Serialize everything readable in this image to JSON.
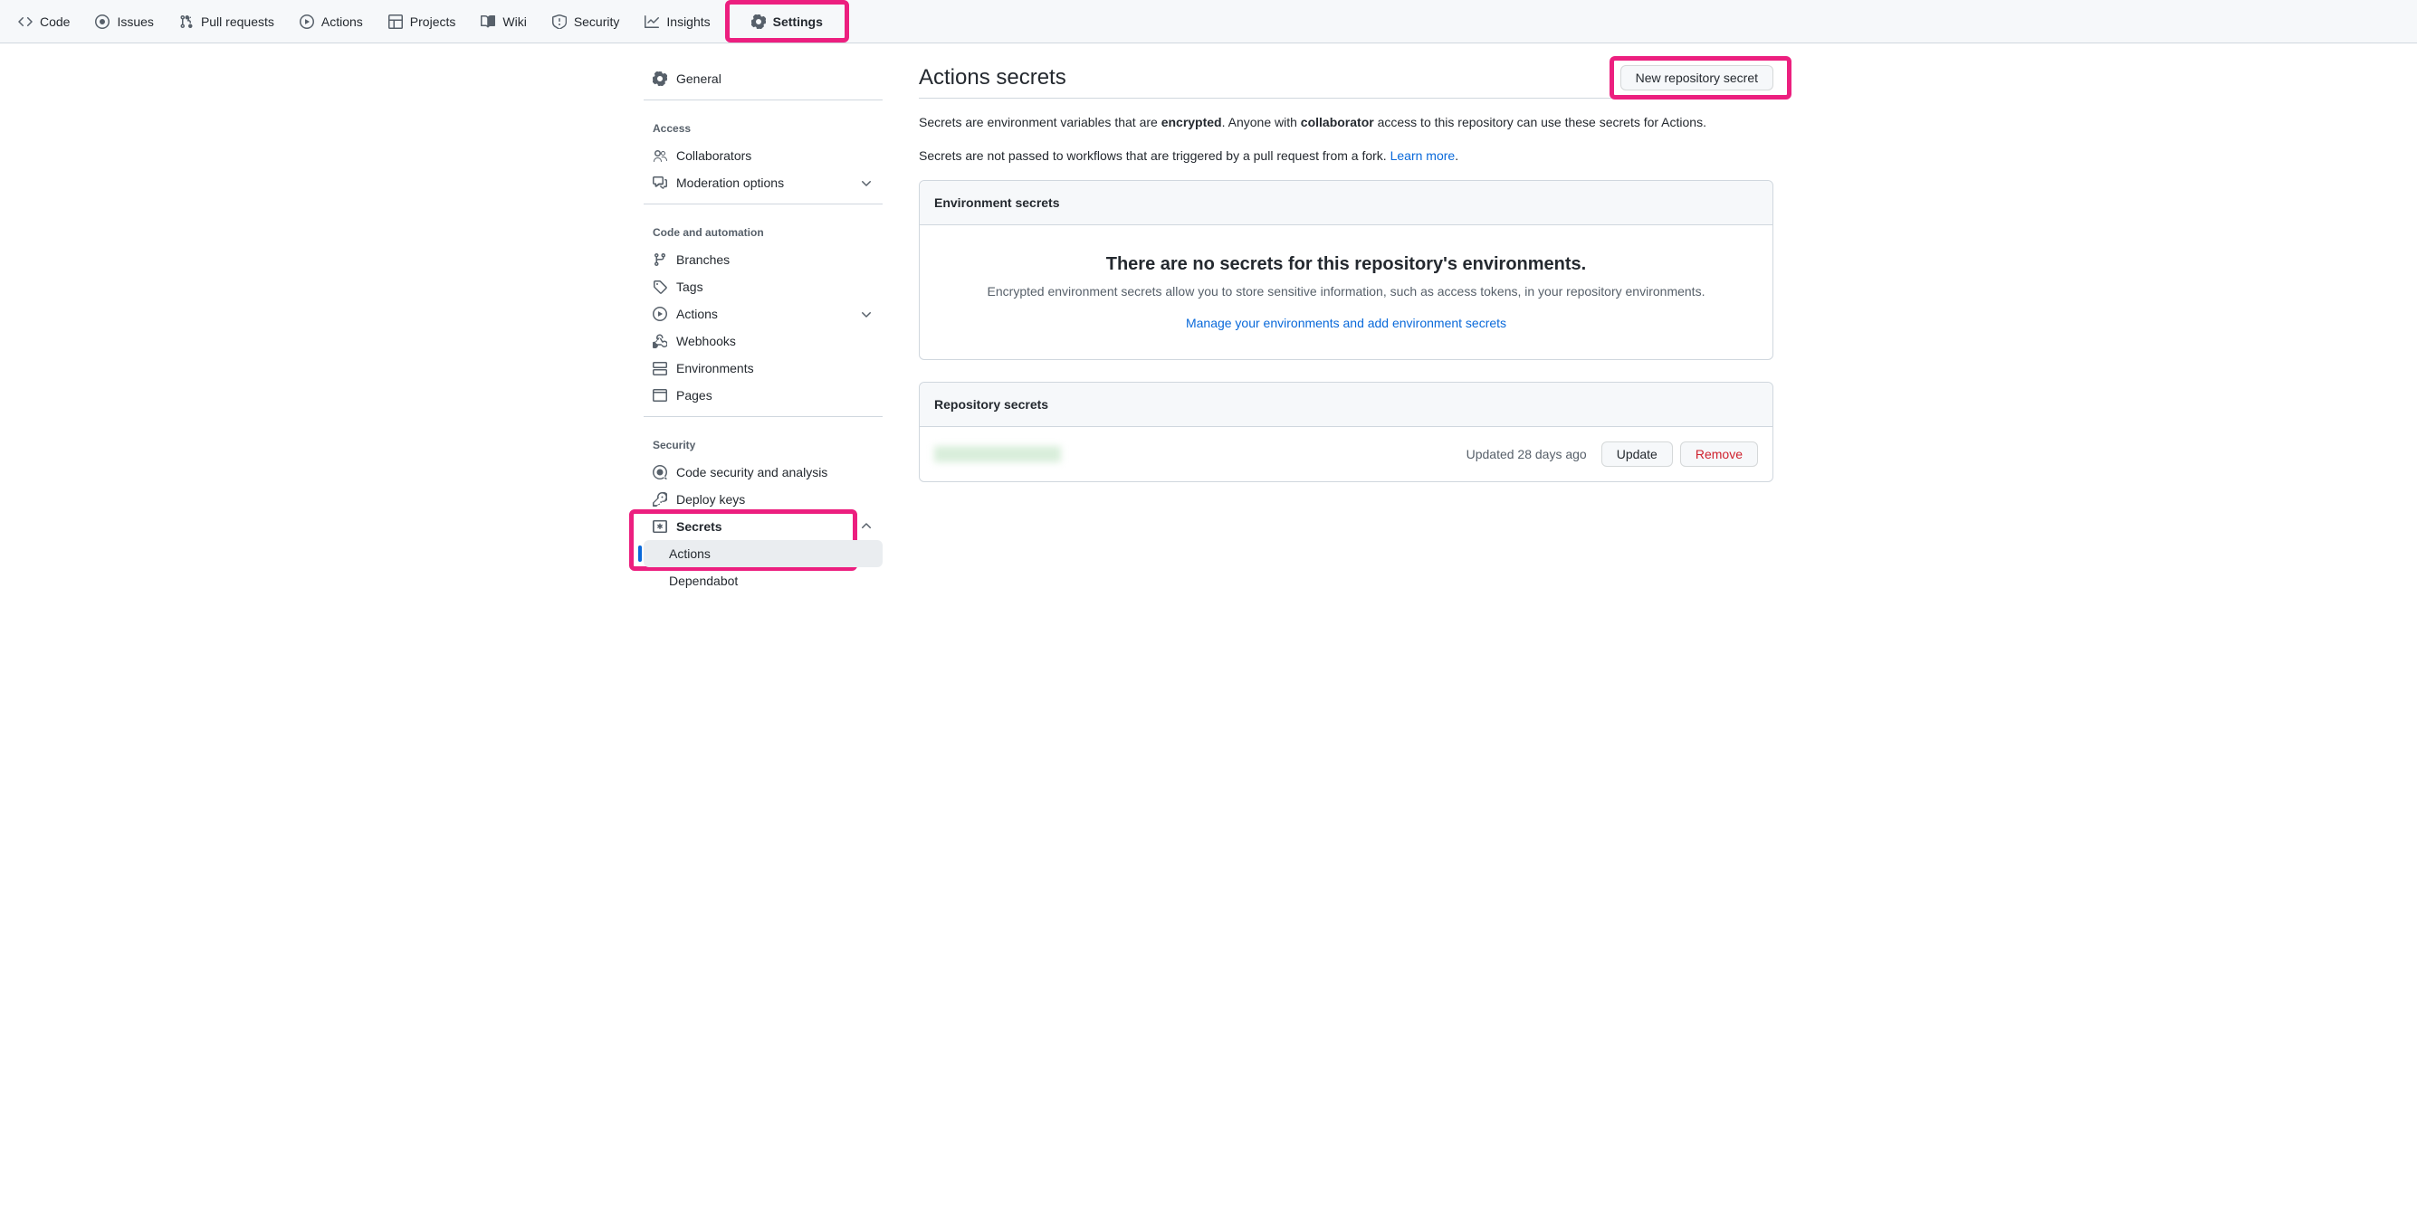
{
  "topnav": {
    "code": "Code",
    "issues": "Issues",
    "pulls": "Pull requests",
    "actions": "Actions",
    "projects": "Projects",
    "wiki": "Wiki",
    "security": "Security",
    "insights": "Insights",
    "settings": "Settings"
  },
  "sidebar": {
    "general": "General",
    "access_label": "Access",
    "collaborators": "Collaborators",
    "moderation": "Moderation options",
    "code_label": "Code and automation",
    "branches": "Branches",
    "tags": "Tags",
    "actions": "Actions",
    "webhooks": "Webhooks",
    "environments": "Environments",
    "pages": "Pages",
    "security_label": "Security",
    "code_security": "Code security and analysis",
    "deploy_keys": "Deploy keys",
    "secrets": "Secrets",
    "secrets_actions": "Actions",
    "secrets_dependabot": "Dependabot"
  },
  "page": {
    "title": "Actions secrets",
    "new_secret_btn": "New repository secret",
    "desc1_pre": "Secrets are environment variables that are ",
    "desc1_b1": "encrypted",
    "desc1_mid": ". Anyone with ",
    "desc1_b2": "collaborator",
    "desc1_post": " access to this repository can use these secrets for Actions.",
    "desc2_pre": "Secrets are not passed to workflows that are triggered by a pull request from a fork. ",
    "desc2_link": "Learn more",
    "desc2_post": "."
  },
  "env_box": {
    "header": "Environment secrets",
    "empty_title": "There are no secrets for this repository's environments.",
    "empty_desc": "Encrypted environment secrets allow you to store sensitive information, such as access tokens, in your repository environments.",
    "manage_link": "Manage your environments and add environment secrets"
  },
  "repo_box": {
    "header": "Repository secrets",
    "secret_updated": "Updated 28 days ago",
    "update_btn": "Update",
    "remove_btn": "Remove"
  }
}
